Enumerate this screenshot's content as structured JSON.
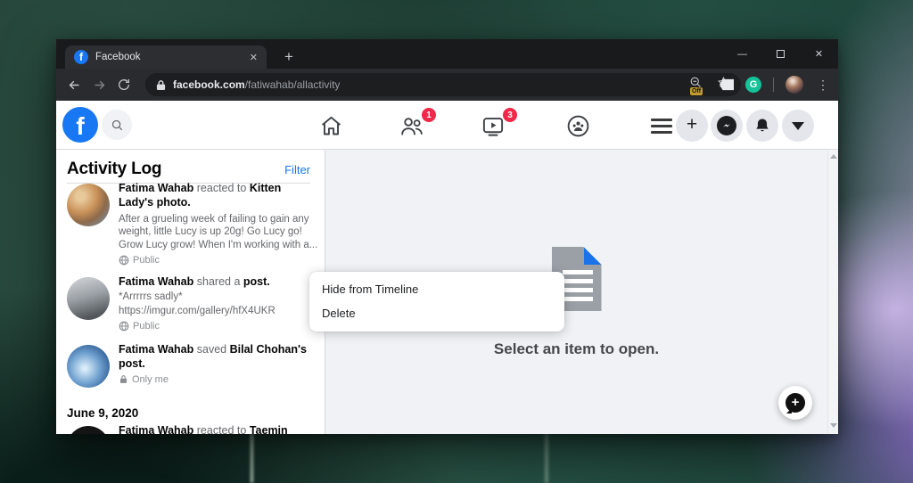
{
  "colors": {
    "accent": "#1877f2",
    "badge_red": "#f02849",
    "grammarly_green": "#15c39a"
  },
  "browser": {
    "tab_title": "Facebook",
    "tab_close_glyph": "✕",
    "new_tab_glyph": "+",
    "window_controls": {
      "minimize_glyph": "—",
      "close_glyph": "✕"
    },
    "address": {
      "host": "facebook.com",
      "path": "/fatiwahab/allactivity"
    },
    "extensions": {
      "off_badge": "Off",
      "grammarly_letter": "G"
    },
    "kebab_glyph": "⋮"
  },
  "facebook": {
    "logo_letter": "f",
    "nav": {
      "friends_badge": "1",
      "watch_badge": "3",
      "plus_glyph": "+"
    },
    "activity_log": {
      "title": "Activity Log",
      "filter_label": "Filter",
      "entries": [
        {
          "actor": "Fatima Wahab",
          "action": " reacted to ",
          "target": "Kitten Lady's photo.",
          "body": "After a grueling week of failing to gain any weight, little Lucy is up 20g! Go Lucy go! Grow Lucy grow! When I'm working with a...",
          "privacy": "Public"
        },
        {
          "actor": "Fatima Wahab",
          "action": " shared a ",
          "target": "post.",
          "line1": "*Arrrrrs sadly*",
          "line2": "https://imgur.com/gallery/hfX4UKR",
          "privacy": "Public"
        },
        {
          "actor": "Fatima Wahab",
          "action": " saved ",
          "target": "Bilal Chohan's post.",
          "privacy": "Only me"
        }
      ],
      "date_header": "June 9, 2020",
      "partial_entry": {
        "actor": "Fatima Wahab",
        "action": " reacted to ",
        "target": "Taemin"
      }
    },
    "context_menu": {
      "items": [
        "Hide from Timeline",
        "Delete"
      ]
    },
    "main_panel": {
      "empty_text": "Select an item to open.",
      "plus_glyph": "+"
    }
  }
}
